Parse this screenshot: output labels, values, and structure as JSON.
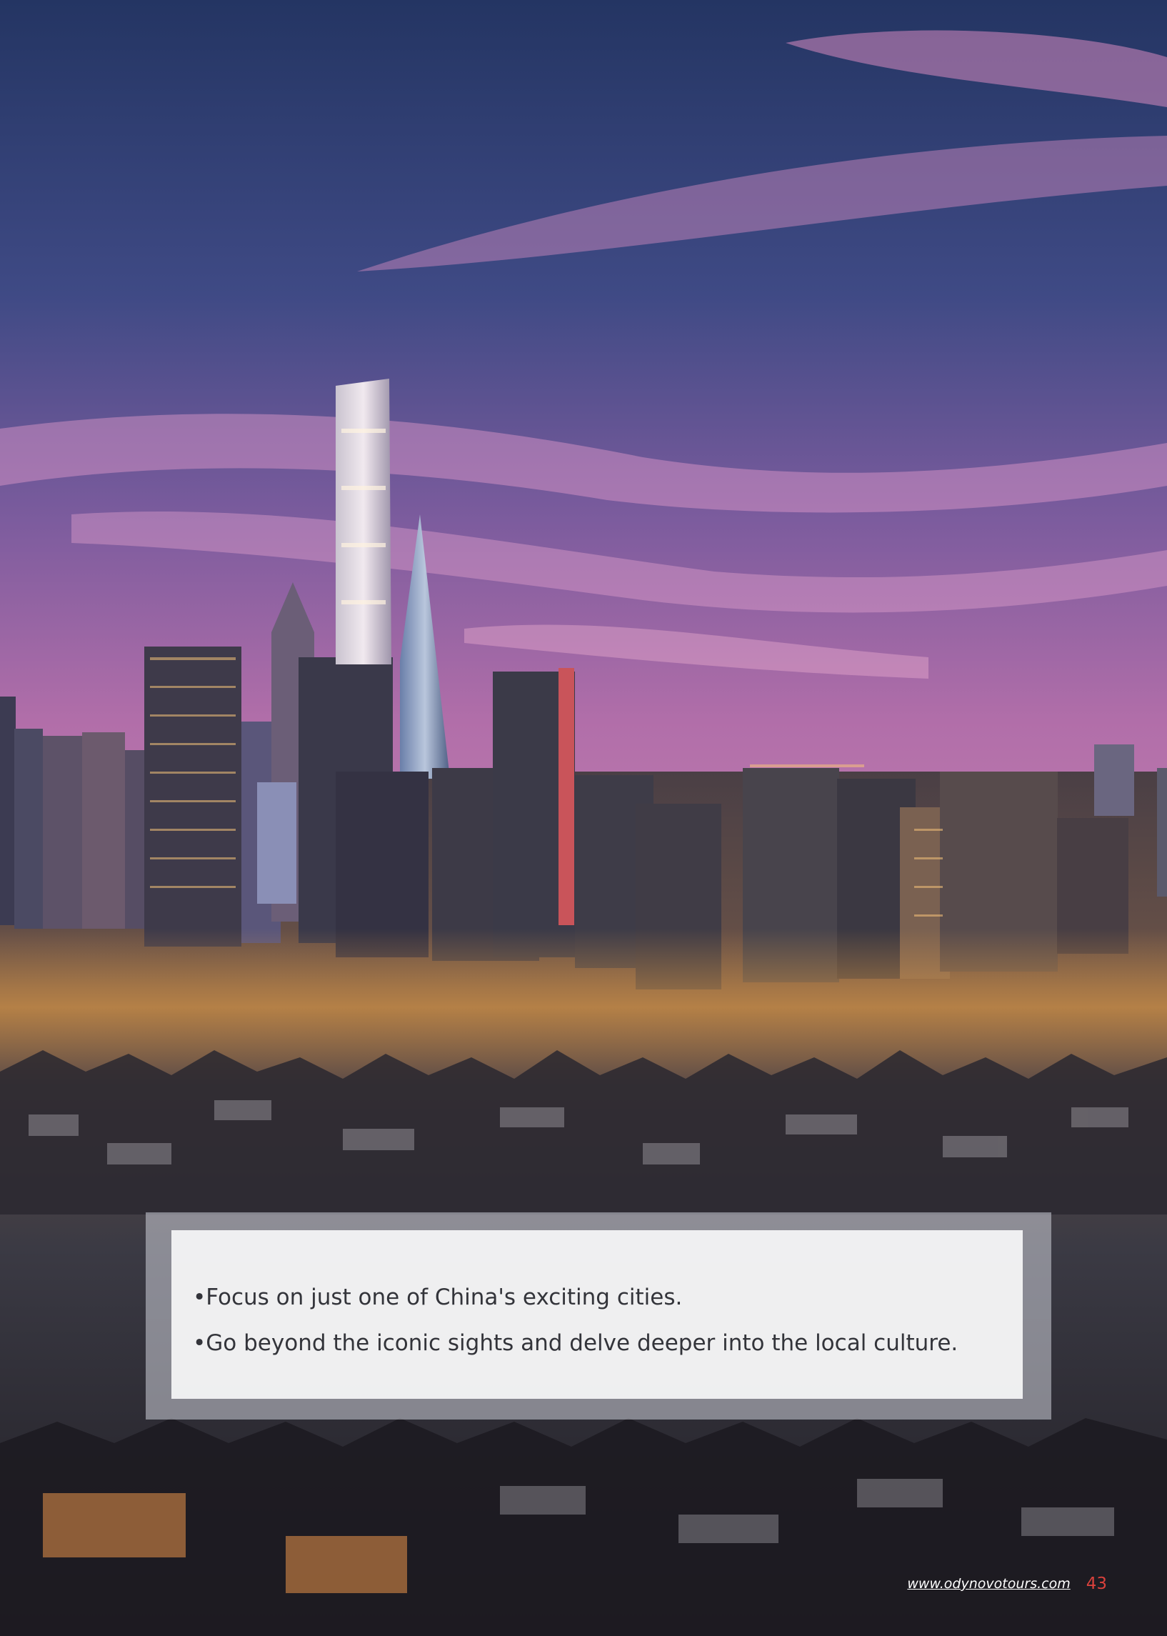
{
  "bullets": [
    "•Focus on just one of China's exciting cities.",
    "•Go beyond the iconic sights and delve deeper into the local culture."
  ],
  "footer": {
    "url": "www.odynovotours.com",
    "page_number": "43"
  },
  "colors": {
    "page_number": "#d9413c",
    "box_text": "#33343a"
  }
}
